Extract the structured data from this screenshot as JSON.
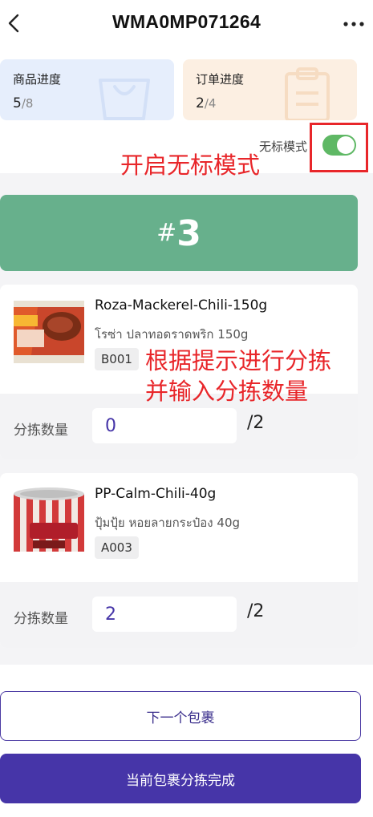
{
  "header": {
    "title": "WMA0MP071264",
    "back_icon": "chevron-left-icon",
    "more_icon": "more-horizontal-icon"
  },
  "progress": {
    "goods": {
      "label": "商品进度",
      "done": "5",
      "total": "/8"
    },
    "orders": {
      "label": "订单进度",
      "done": "2",
      "total": "/4"
    }
  },
  "mode": {
    "label": "无标模式",
    "enabled": true
  },
  "annotations": {
    "enable_hint": "开启无标模式",
    "sort_hint_line1": "根据提示进行分拣",
    "sort_hint_line2": "并输入分拣数量"
  },
  "package": {
    "hash": "#",
    "number": "3"
  },
  "items": [
    {
      "name": "Roza-Mackerel-Chili-150g",
      "thai_name": "โรซ่า ปลาทอดราดพริก 150g",
      "location": "B001",
      "pick_label": "分拣数量",
      "pick_value": "0",
      "pick_total": "/2"
    },
    {
      "name": "PP-Calm-Chili-40g",
      "thai_name": "ปุ้มปุ้ย หอยลายกระป๋อง 40g",
      "location": "A003",
      "pick_label": "分拣数量",
      "pick_value": "2",
      "pick_total": "/2"
    }
  ],
  "buttons": {
    "next": "下一个包裹",
    "done": "当前包裹分拣完成"
  },
  "colors": {
    "banner": "#67b08c",
    "primary": "#4635a8",
    "toggle_on": "#5fb865",
    "annotation": "#e8262a"
  }
}
